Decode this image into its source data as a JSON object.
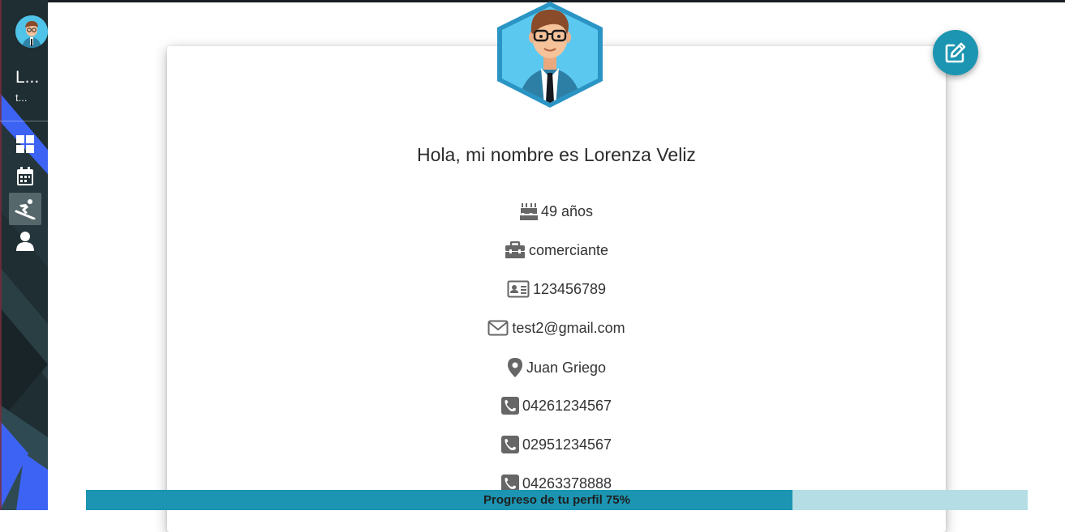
{
  "sidebar": {
    "user_name": "L...",
    "user_sub": "t...",
    "nav": [
      {
        "icon": "dashboard-grid-icon"
      },
      {
        "icon": "calendar-icon"
      },
      {
        "icon": "snowboarder-icon",
        "active": true
      },
      {
        "icon": "user-icon"
      }
    ]
  },
  "profile": {
    "greeting": "Hola, mi nombre es Lorenza Veliz",
    "age": "49 años",
    "occupation": "comerciante",
    "id_number": "123456789",
    "email": "test2@gmail.com",
    "location": "Juan Griego",
    "phones": [
      "04261234567",
      "02951234567",
      "04263378888"
    ]
  },
  "edit_button": {
    "icon": "edit-icon"
  },
  "progress": {
    "label": "Progreso de tu perfil 75%",
    "value": 75
  },
  "colors": {
    "accent": "#1b95b1",
    "progress_track": "#b4dde6",
    "sidebar_blue": "#3d63f5",
    "sidebar_dark": "#1f2e33"
  }
}
